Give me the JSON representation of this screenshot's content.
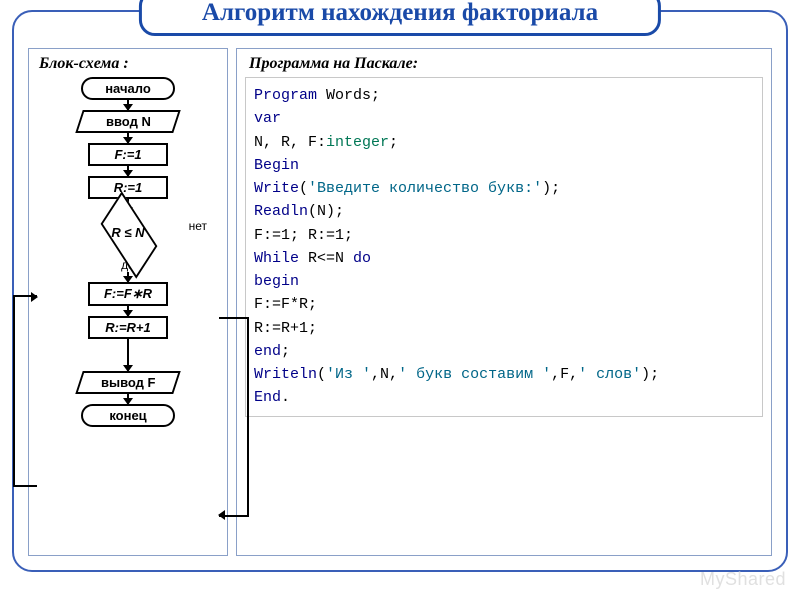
{
  "title": "Алгоритм нахождения факториала",
  "left_title": "Блок-схема :",
  "right_title": "Программа на Паскале:",
  "flow": {
    "start": "начало",
    "input": "ввод N",
    "p1": "F:=1",
    "p2": "R:=1",
    "cond": "R ≤ N",
    "yes": "да",
    "no": "нет",
    "p3": "F:=F∗R",
    "p4": "R:=R+1",
    "output": "вывод F",
    "end": "конец"
  },
  "code": {
    "l1_kw": "Program",
    "l1_rest": " Words;",
    "l2_kw": "var",
    "l3_a": "N, R, F:",
    "l3_tp": "integer",
    "l3_b": ";",
    "l4_kw": "Begin",
    "l5_kw": "Write",
    "l5_a": "(",
    "l5_str": "'Введите количество букв:'",
    "l5_b": ");",
    "l6_kw": "Readln",
    "l6_a": "(N);",
    "l7": "F:=1; R:=1;",
    "l8_kw1": "While",
    "l8_a": " R<=N ",
    "l8_kw2": "do",
    "l9_kw": "begin",
    "l10": "F:=F*R;",
    "l11": "R:=R+1;",
    "l12_kw": "end",
    "l12_a": ";",
    "l13_kw": "Writeln",
    "l13_a": "(",
    "l13_s1": "'Из '",
    "l13_b": ",N,",
    "l13_s2": "' букв составим '",
    "l13_c": ",F,",
    "l13_s3": "' слов'",
    "l13_d": ");",
    "l14_kw": "End",
    "l14_a": "."
  },
  "watermark": "MyShared"
}
